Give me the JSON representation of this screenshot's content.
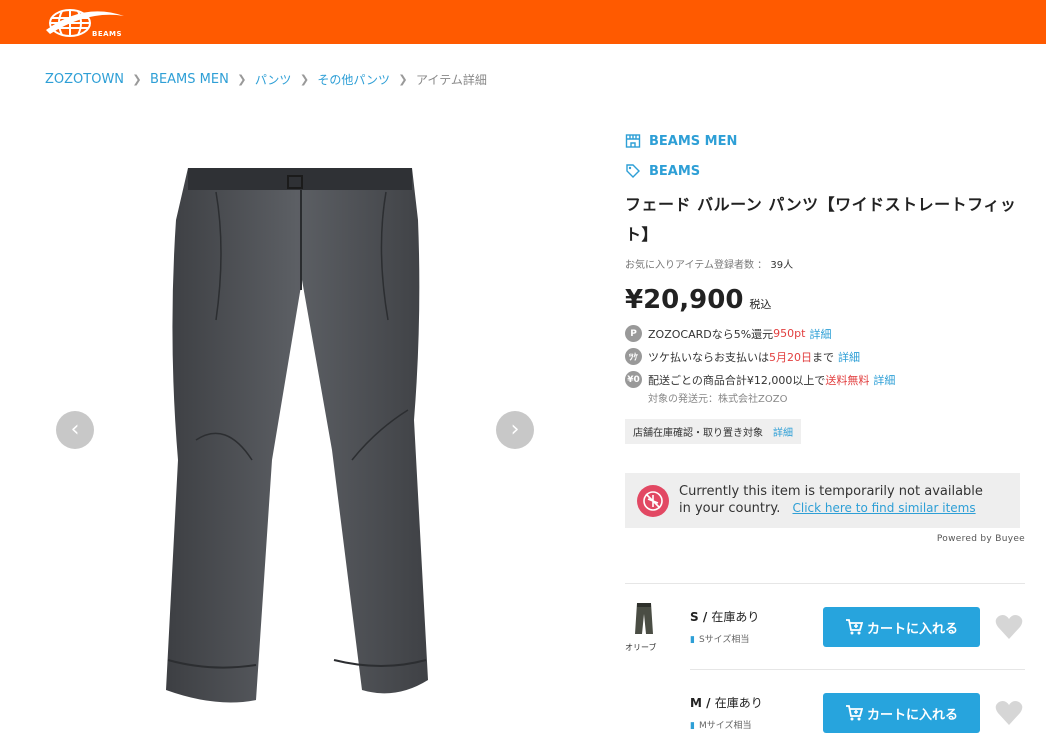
{
  "header": {
    "logo_text": "BEAMS",
    "brand_color": "#ff5a00"
  },
  "breadcrumb": {
    "items": [
      "ZOZOTOWN",
      "BEAMS MEN",
      "パンツ",
      "その他パンツ",
      "アイテム詳細"
    ]
  },
  "gallery": {
    "prev_icon": "chevron-left-icon",
    "next_icon": "chevron-right-icon"
  },
  "product": {
    "shop": "BEAMS MEN",
    "brand": "BEAMS",
    "title": "フェード バルーン パンツ【ワイドストレートフィット】",
    "favorites_label": "お気に入りアイテム登録者数 ：",
    "favorites_count": "39人",
    "price": "¥20,900",
    "tax_label": "税込",
    "perks": [
      {
        "icon": "P",
        "text_a": "ZOZOCARDなら5%還元",
        "text_red": "950pt",
        "text_b": "",
        "link": "詳細"
      },
      {
        "icon": "ﾂｹ",
        "text_a": "ツケ払いならお支払いは",
        "text_red": "5月20日",
        "text_b": "まで",
        "link": "詳細"
      },
      {
        "icon": "¥0",
        "text_a": "配送ごとの商品合計¥12,000以上で",
        "text_red": "送料無料",
        "text_b": "",
        "link": "詳細"
      }
    ],
    "shipper": "対象の発送元：株式会社ZOZO",
    "store_tag": "店舗在庫確認・取り置き対象",
    "store_tag_link": "詳細"
  },
  "buyee": {
    "line1": "Currently this item is temporarily not available",
    "line2": "in your country.",
    "link": "Click here to find similar items",
    "powered": "Powered by Buyee"
  },
  "color": {
    "name": "オリーブ"
  },
  "skus": [
    {
      "size": "S",
      "sep": " / ",
      "stock": "在庫あり",
      "fit": "Sサイズ相当",
      "button": "カートに入れる"
    },
    {
      "size": "M",
      "sep": " / ",
      "stock": "在庫あり",
      "fit": "Mサイズ相当",
      "button": "カートに入れる"
    }
  ],
  "colors": {
    "link": "#2e9fd6",
    "accent_red": "#e24040",
    "cart_button": "#27a4dd"
  }
}
